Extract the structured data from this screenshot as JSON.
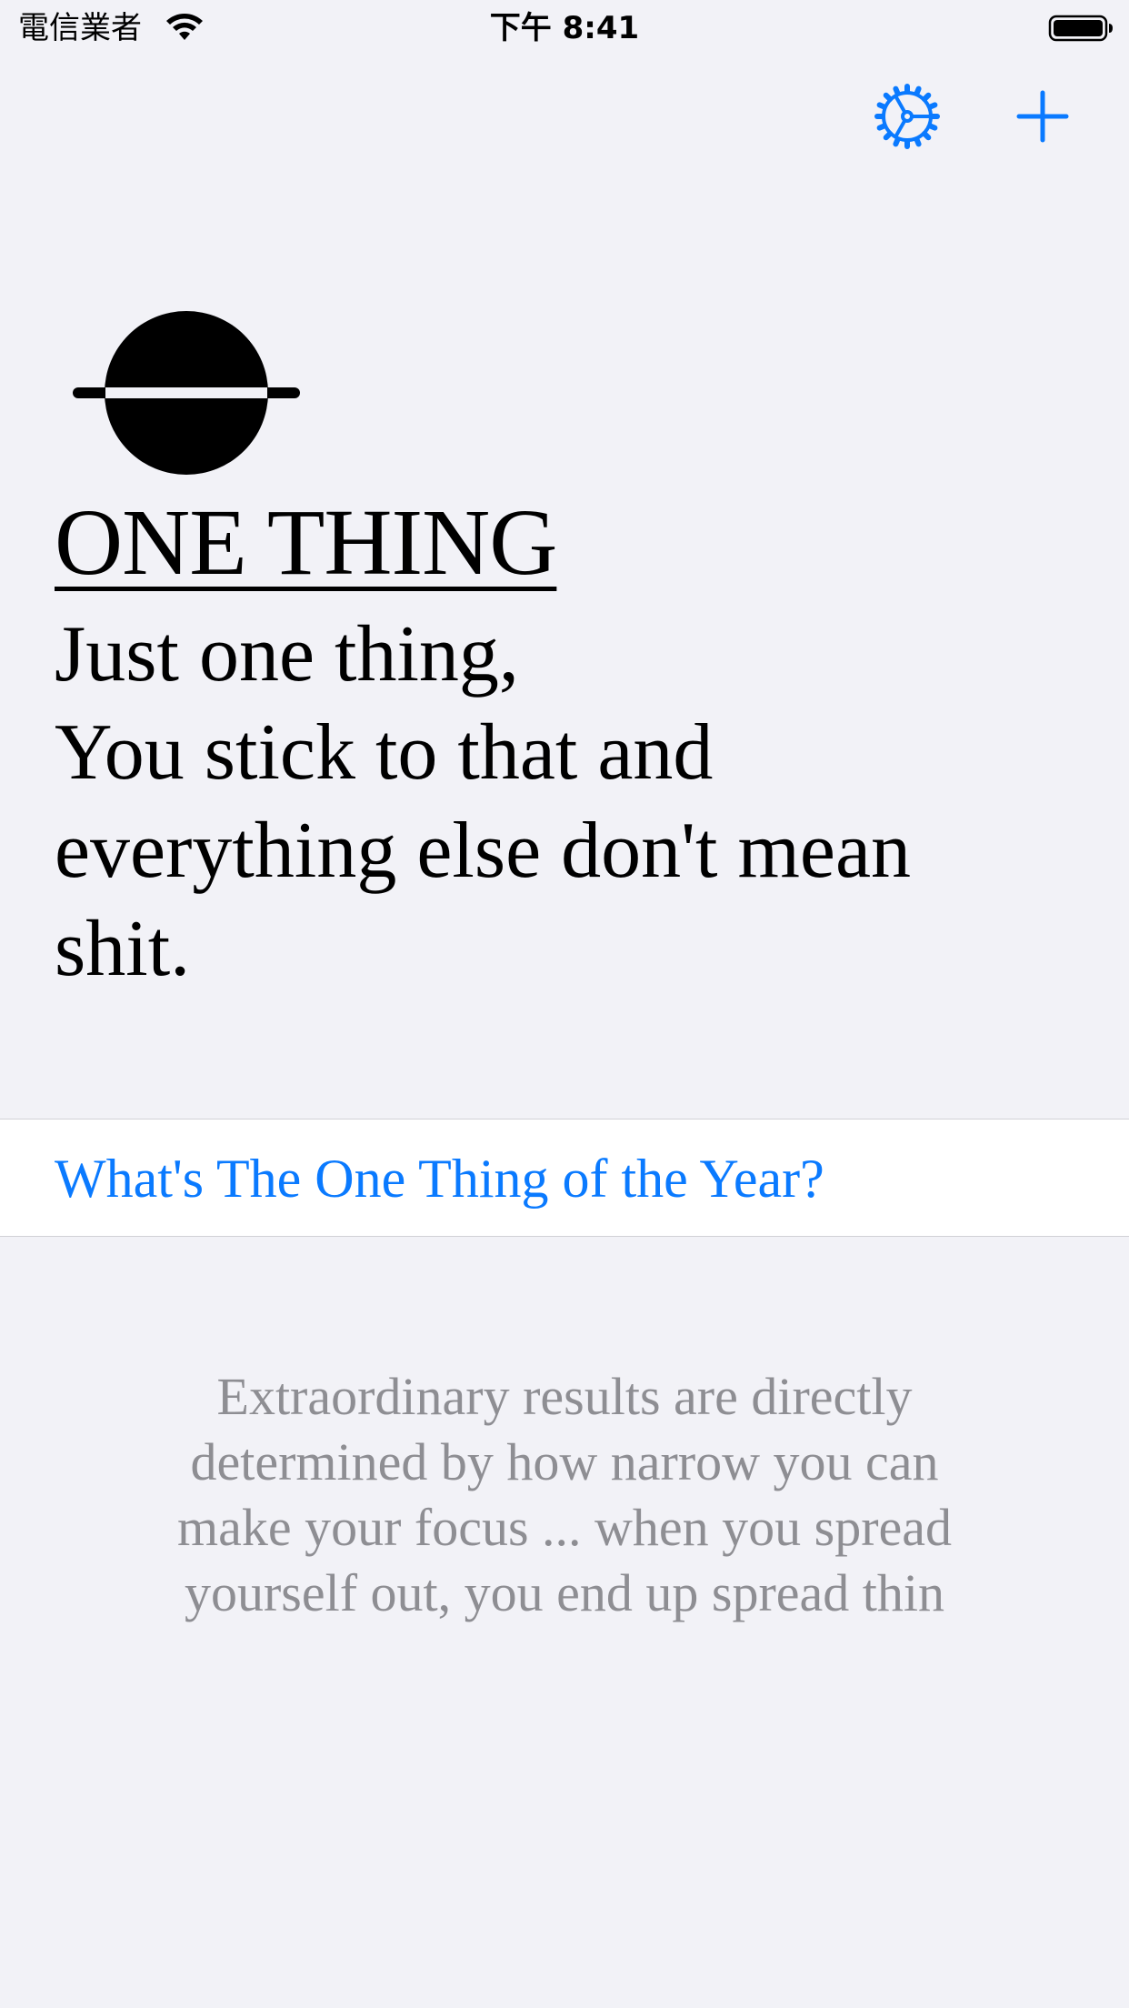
{
  "status_bar": {
    "carrier": "電信業者",
    "time": "下午 8:41"
  },
  "nav": {
    "settings_icon": "settings-gear-icon",
    "add_icon": "plus-icon",
    "accent_color": "#0a7aff"
  },
  "hero": {
    "title": "ONE THING",
    "quote_lines": [
      "Just one thing,",
      "You stick to that and",
      "everything else don't mean",
      "shit."
    ]
  },
  "cell": {
    "label": "What's The One Thing of the Year?"
  },
  "footer": {
    "lines": [
      "Extraordinary results are directly",
      "determined by how narrow you can",
      "make your focus ... when you spread",
      "yourself out, you end up spread thin"
    ]
  }
}
